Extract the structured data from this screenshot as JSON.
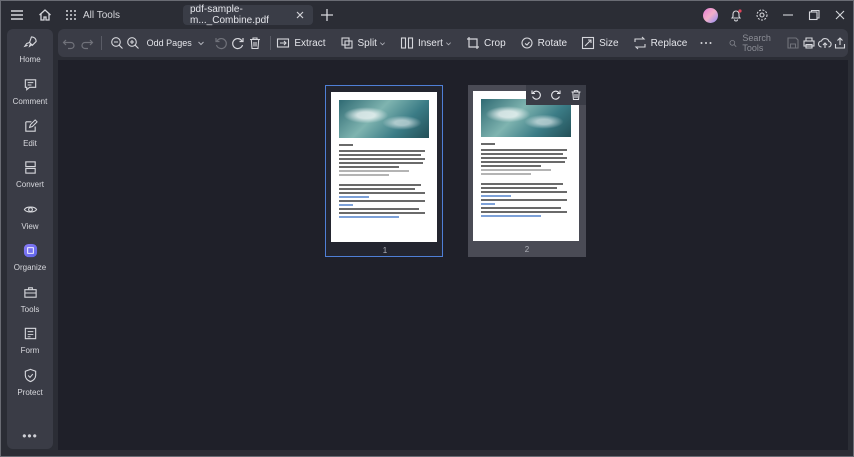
{
  "titlebar": {
    "all_tools_label": "All Tools",
    "tab_title": "pdf-sample-m..._Combine.pdf"
  },
  "sidebar": {
    "items": [
      {
        "label": "Home",
        "icon": "rocket-icon"
      },
      {
        "label": "Comment",
        "icon": "comment-icon"
      },
      {
        "label": "Edit",
        "icon": "edit-icon"
      },
      {
        "label": "Convert",
        "icon": "convert-icon"
      },
      {
        "label": "View",
        "icon": "eye-icon"
      },
      {
        "label": "Organize",
        "icon": "organize-icon"
      },
      {
        "label": "Tools",
        "icon": "toolbox-icon"
      },
      {
        "label": "Form",
        "icon": "form-icon"
      },
      {
        "label": "Protect",
        "icon": "shield-icon"
      }
    ],
    "more_label": "•••",
    "active_color": "#7b6cf0"
  },
  "toolbar": {
    "page_filter_value": "Odd Pages",
    "extract_label": "Extract",
    "split_label": "Split",
    "insert_label": "Insert",
    "crop_label": "Crop",
    "rotate_label": "Rotate",
    "size_label": "Size",
    "replace_label": "Replace",
    "search_placeholder": "Search Tools"
  },
  "pages": [
    {
      "number": "1",
      "selected": true
    },
    {
      "number": "2",
      "selected": false
    }
  ],
  "colors": {
    "selection": "#4f7fd6",
    "canvas": "#1f2029"
  }
}
